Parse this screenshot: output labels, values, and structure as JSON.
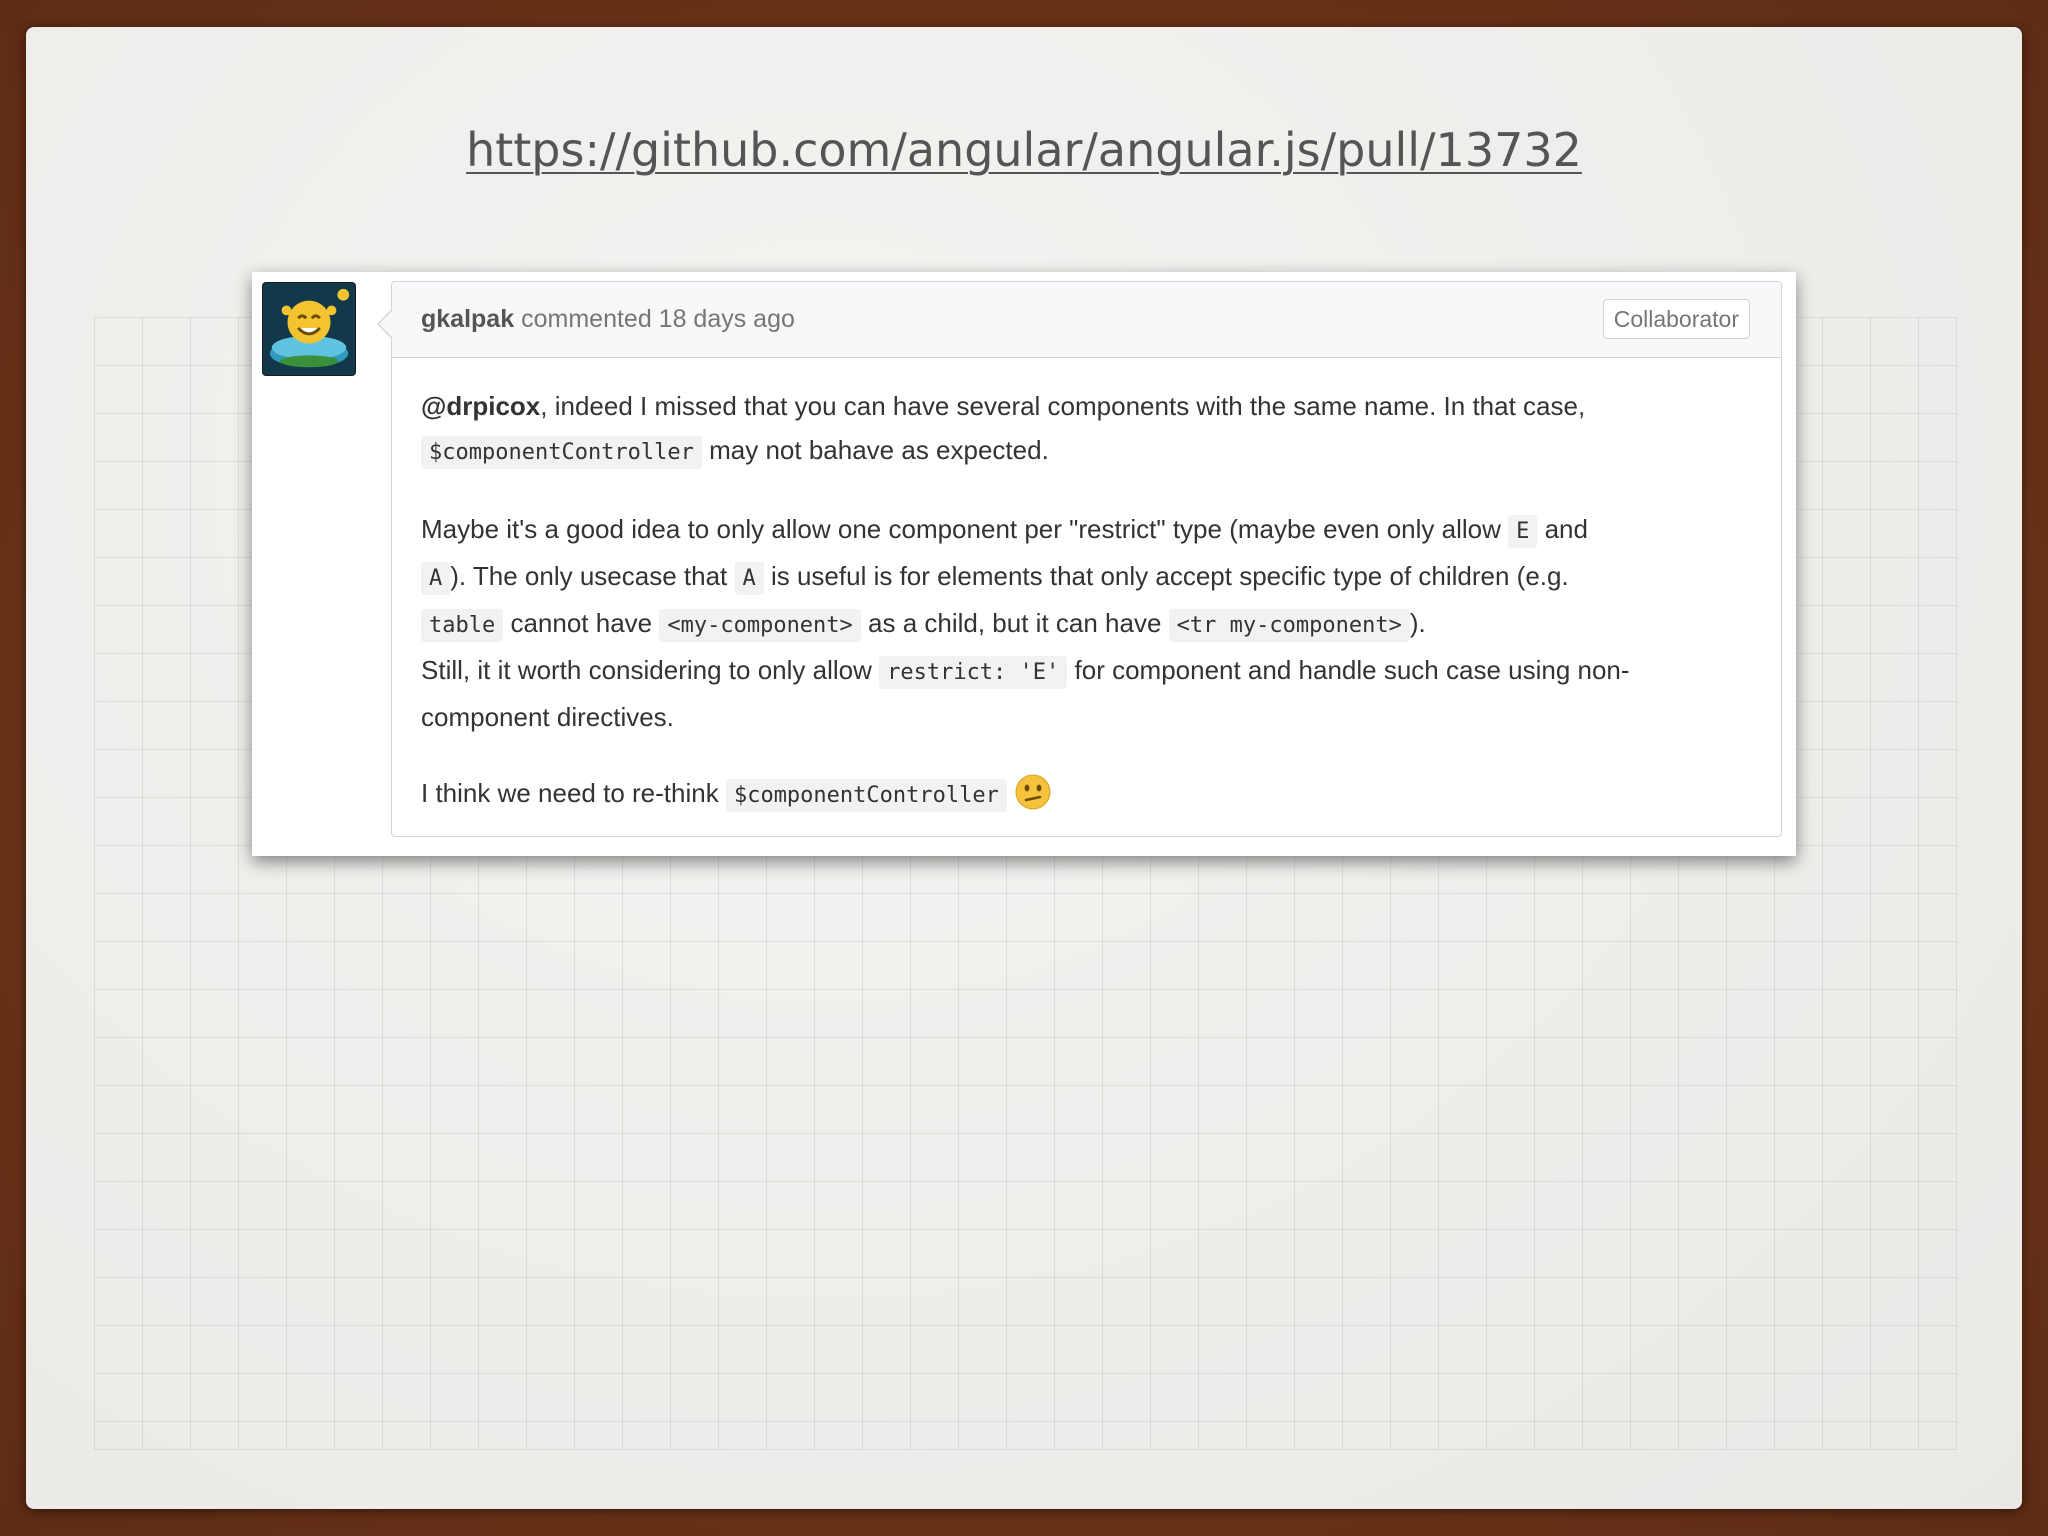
{
  "slide": {
    "url": "https://github.com/angular/angular.js/pull/13732"
  },
  "comment": {
    "avatar_icon": "avatar-ufo-smiley-icon",
    "author": "gkalpak",
    "meta": "commented 18 days ago",
    "role_badge": "Collaborator",
    "paragraphs": {
      "p1": {
        "mention": "@drpicox",
        "t1": ", indeed I missed that you can have several components with the same name. In that case,",
        "c1": "$componentController",
        "t2": " may not bahave as expected."
      },
      "p2": {
        "t1": "Maybe it's a good idea to only allow one component per \"restrict\" type (maybe even only allow ",
        "c1": "E",
        "t2": " and",
        "c2": "A",
        "t3": "). The only usecase that ",
        "c3": "A",
        "t4": " is useful is for elements that only accept specific type of children (e.g.",
        "c4": "table",
        "t5": " cannot have ",
        "c5": "<my-component>",
        "t6": " as a child, but it can have ",
        "c6": "<tr my-component>",
        "t7": ").",
        "t8": "Still, it it worth considering to only allow ",
        "c7": "restrict: 'E'",
        "t9": " for component and handle such case using non-component directives."
      },
      "p3": {
        "t1": "I think we need to re-think ",
        "c1": "$componentController",
        "emoji": "confused-face-icon"
      }
    }
  },
  "colors": {
    "frame": "#6f3519",
    "slide_bg": "#efeeec",
    "header_bg": "#f6f8fa",
    "border": "#d1d5da",
    "emoji_yellow": "#f5c33b"
  }
}
